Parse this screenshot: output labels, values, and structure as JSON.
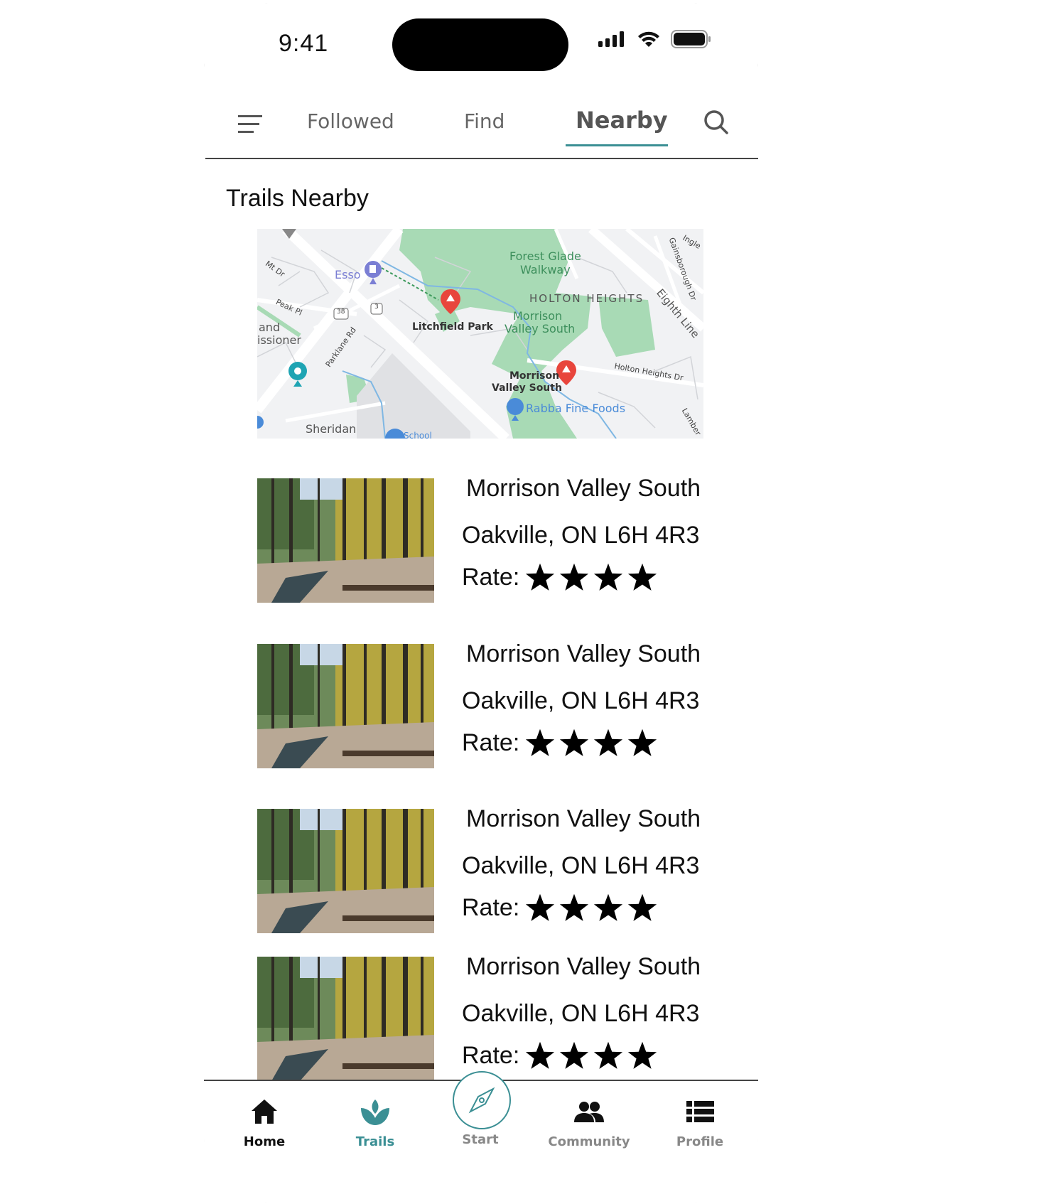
{
  "status_bar": {
    "time": "9:41"
  },
  "tabs": [
    {
      "label": "Followed",
      "active": false
    },
    {
      "label": "Find",
      "active": false
    },
    {
      "label": "Nearby",
      "active": true
    }
  ],
  "section_title": "Trails Nearby",
  "map": {
    "labels": {
      "forest_glade": "Forest Glade",
      "walkway": "Walkway",
      "holton_heights": "HOLTON HEIGHTS",
      "morrison": "Morrison",
      "valley_south": "Valley South",
      "litchfield_park": "Litchfield Park",
      "esso": "Esso",
      "morrison2": "Morrison",
      "valley_south2": "Valley South",
      "rabba": "Rabba Fine Foods",
      "holton_heights_dr": "Holton Heights Dr",
      "eighth_line": "Eighth Line",
      "gainsborough": "Gainsborough Dr",
      "peak_pl": "Peak Pl",
      "mt_dr": "Mt Dr",
      "parklane": "Parklane Rd",
      "and": "and",
      "issioner": "issioner",
      "sheridan": "Sheridan",
      "school": "School",
      "route_38": "38",
      "route_3": "3",
      "ingle": "Ingle",
      "lamber": "Lamber"
    }
  },
  "trails": [
    {
      "name": "Morrison Valley South",
      "address": "Oakville, ON L6H 4R3",
      "rate_label": "Rate:",
      "stars": 4
    },
    {
      "name": "Morrison Valley South",
      "address": "Oakville, ON L6H 4R3",
      "rate_label": "Rate:",
      "stars": 4
    },
    {
      "name": "Morrison Valley South",
      "address": "Oakville, ON L6H 4R3",
      "rate_label": "Rate:",
      "stars": 4
    },
    {
      "name": "Morrison Valley South",
      "address": "Oakville, ON L6H 4R3",
      "rate_label": "Rate:",
      "stars": 4
    }
  ],
  "bottom_nav": [
    {
      "label": "Home",
      "icon": "home-icon"
    },
    {
      "label": "Trails",
      "icon": "leaf-icon"
    },
    {
      "label": "Start",
      "icon": "compass-icon"
    },
    {
      "label": "Community",
      "icon": "people-icon"
    },
    {
      "label": "Profile",
      "icon": "list-icon"
    }
  ],
  "colors": {
    "accent": "#3b8f94",
    "pin_red": "#e8453c",
    "park_green": "#a8dab5"
  }
}
